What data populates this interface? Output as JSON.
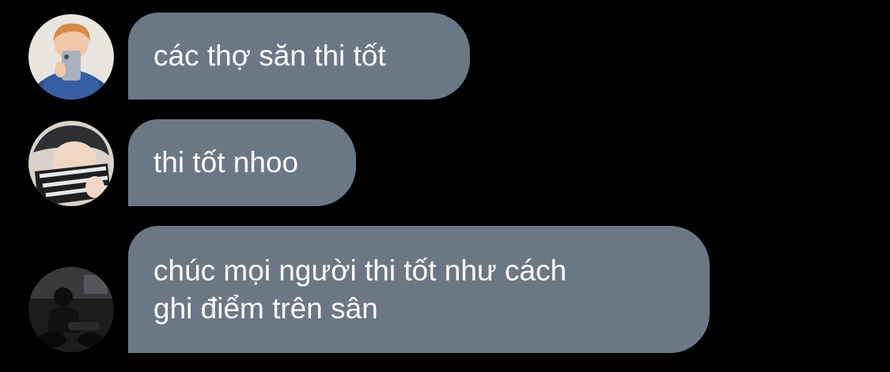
{
  "theme": {
    "background": "#000000",
    "bubble_color": "#6a7886",
    "text_color": "#ffffff"
  },
  "messages": [
    {
      "avatar": "avatar-icon",
      "text": "các thợ săn thi tốt"
    },
    {
      "avatar": "avatar-icon",
      "text": "thi tốt nhoo"
    },
    {
      "avatar": "avatar-icon",
      "text": "chúc mọi người thi tốt như cách\nghi điểm trên sân"
    }
  ]
}
